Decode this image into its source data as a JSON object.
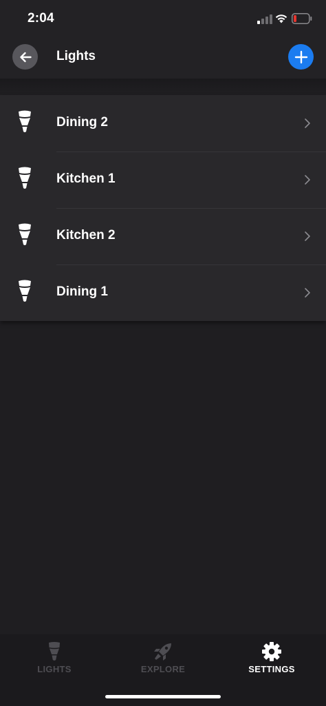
{
  "status_bar": {
    "time": "2:04",
    "battery_color": "#e5352f"
  },
  "header": {
    "title": "Lights",
    "back_icon": "arrow-left-icon",
    "add_icon": "plus-icon",
    "accent_color": "#1b7cf0"
  },
  "lights": [
    {
      "label": "Dining 2",
      "icon": "bulb-icon"
    },
    {
      "label": "Kitchen 1",
      "icon": "bulb-icon"
    },
    {
      "label": "Kitchen 2",
      "icon": "bulb-icon"
    },
    {
      "label": "Dining 1",
      "icon": "bulb-icon"
    }
  ],
  "tabs": [
    {
      "label": "LIGHTS",
      "icon": "bulb-icon",
      "active": false
    },
    {
      "label": "EXPLORE",
      "icon": "rocket-icon",
      "active": false
    },
    {
      "label": "SETTINGS",
      "icon": "gear-icon",
      "active": true
    }
  ]
}
